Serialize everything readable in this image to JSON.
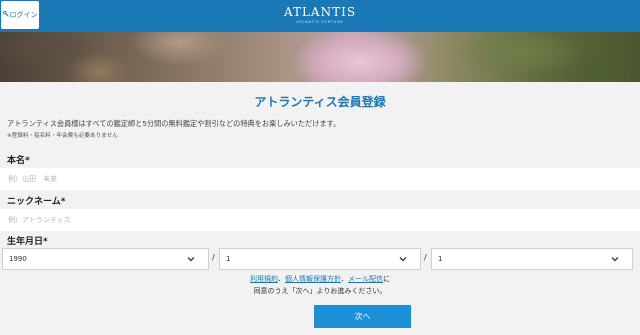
{
  "header": {
    "login_label": "ログイン",
    "logo_text": "ATLANTIS",
    "logo_subtext": "ATLANTIS FORTUNE"
  },
  "form": {
    "title": "アトランティス会員登録",
    "intro": "アトランティス会員様はすべての鑑定師と5分間の無料鑑定や割引などの特典をお楽しみいただけます。",
    "note": "※登録料・指名料・年会費も必要ありません",
    "name": {
      "label": "本名",
      "required_mark": "*",
      "placeholder": "例）山田　未来"
    },
    "nickname": {
      "label": "ニックネーム",
      "required_mark": "*",
      "placeholder": "例）アトランティス"
    },
    "birthdate": {
      "label": "生年月日",
      "required_mark": "*",
      "year": "1990",
      "month": "1",
      "day": "1",
      "separator": "/"
    },
    "consent": {
      "link_terms": "利用規約",
      "link_privacy": "個人情報保護方針",
      "link_mail": "メール配信",
      "sep1": "、",
      "sep2": "、",
      "tail": "に",
      "line2": "同意のうえ「次へ」よりお進みください。"
    },
    "next_label": "次へ"
  },
  "colors": {
    "header_blue": "#1b78b6",
    "button_blue": "#1c8fd6",
    "page_bg": "#f2f2f2"
  }
}
